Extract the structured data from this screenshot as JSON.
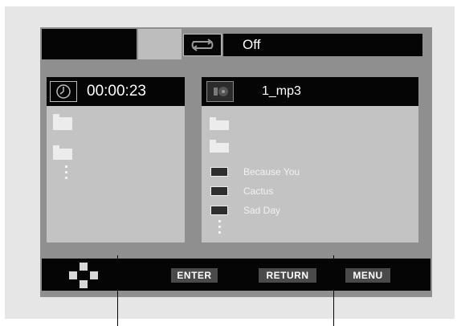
{
  "repeat": {
    "icon": "repeat-icon",
    "value": "Off"
  },
  "time": {
    "icon": "clock-icon",
    "value": "00:00:23"
  },
  "file": {
    "icon": "disc-music-icon",
    "name": "1_mp3"
  },
  "tracks": [
    {
      "icon": "mp3-file-icon",
      "name": "Because You"
    },
    {
      "icon": "wma-file-icon",
      "name": "Cactus"
    },
    {
      "icon": "mp3-file-icon",
      "name": "Sad Day"
    }
  ],
  "buttons": {
    "navigate_icon": "dpad-icon",
    "enter": "ENTER",
    "return": "RETURN",
    "menu": "MENU"
  }
}
